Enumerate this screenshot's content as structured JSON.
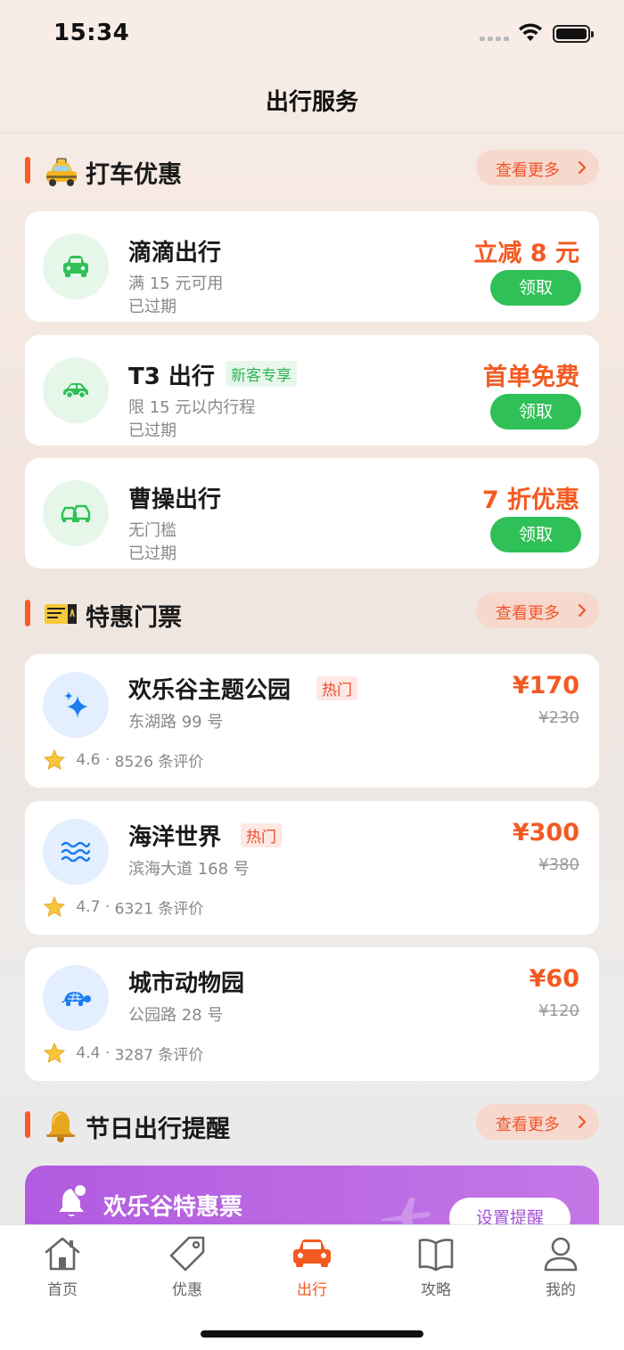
{
  "status_bar": {
    "time": "15:34"
  },
  "nav": {
    "title": "出行服务"
  },
  "sections": {
    "taxi": {
      "emoji": "taxi",
      "title": "打车优惠",
      "more": "查看更多"
    },
    "tickets": {
      "emoji": "ticket",
      "title": "特惠门票",
      "more": "查看更多"
    },
    "holiday": {
      "emoji": "bell",
      "title": "节日出行提醒",
      "more": "查看更多"
    }
  },
  "taxi_coupons": [
    {
      "name": "滴滴出行",
      "tag": "",
      "condition": "满 15 元可用",
      "status": "已过期",
      "offer": "立减 8 元",
      "button": "领取",
      "icon": "car-front-icon"
    },
    {
      "name": "T3 出行",
      "tag": "新客专享",
      "condition": "限 15 元以内行程",
      "status": "已过期",
      "offer": "首单免费",
      "button": "领取",
      "icon": "car-side-icon"
    },
    {
      "name": "曹操出行",
      "tag": "",
      "condition": "无门槛",
      "status": "已过期",
      "offer": "7 折优惠",
      "button": "领取",
      "icon": "cars-icon"
    }
  ],
  "tickets": [
    {
      "name": "欢乐谷主题公园",
      "tag": "热门",
      "address": "东湖路 99 号",
      "price": "¥170",
      "old_price": "¥230",
      "rating": "4.6",
      "reviews": "8526 条评价",
      "icon": "sparkle-icon"
    },
    {
      "name": "海洋世界",
      "tag": "热门",
      "address": "滨海大道 168 号",
      "price": "¥300",
      "old_price": "¥380",
      "rating": "4.7",
      "reviews": "6321 条评价",
      "icon": "waves-icon"
    },
    {
      "name": "城市动物园",
      "tag": "",
      "address": "公园路 28 号",
      "price": "¥60",
      "old_price": "¥120",
      "rating": "4.4",
      "reviews": "3287 条评价",
      "icon": "turtle-icon"
    }
  ],
  "rating_separator": "·",
  "promo": {
    "title": "欢乐谷特惠票",
    "button": "设置提醒"
  },
  "tabbar": [
    {
      "label": "首页",
      "icon": "home-icon",
      "active": false
    },
    {
      "label": "优惠",
      "icon": "tag-icon",
      "active": false
    },
    {
      "label": "出行",
      "icon": "car-icon",
      "active": true
    },
    {
      "label": "攻略",
      "icon": "book-icon",
      "active": false
    },
    {
      "label": "我的",
      "icon": "user-icon",
      "active": false
    }
  ],
  "colors": {
    "accent": "#f35a22",
    "green": "#2fc157",
    "promo": "#b15be0"
  }
}
